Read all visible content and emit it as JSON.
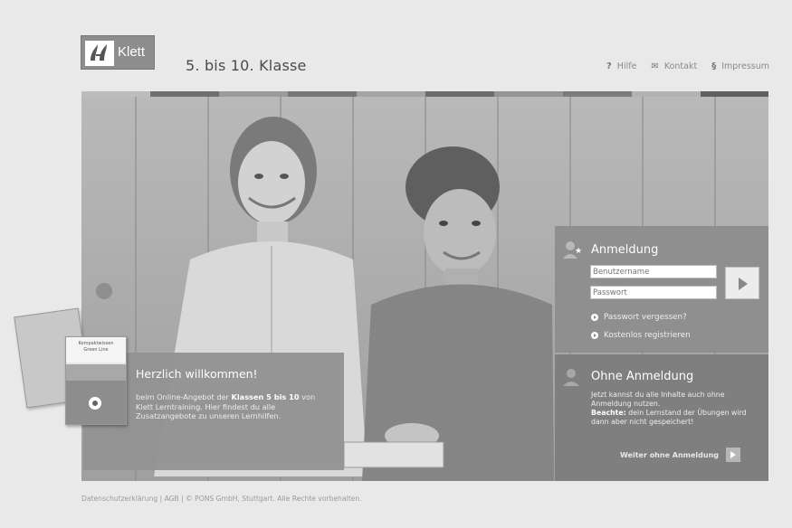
{
  "header": {
    "logo_text": "Klett",
    "grade_title": "5. bis 10. Klasse",
    "nav": [
      {
        "icon": "question-icon",
        "symbol": "?",
        "label": "Hilfe"
      },
      {
        "icon": "mail-icon",
        "symbol": "✉",
        "label": "Kontakt"
      },
      {
        "icon": "paragraph-icon",
        "symbol": "§",
        "label": "Impressum"
      }
    ]
  },
  "colorbar": [
    "#bdbdbd",
    "#6f6f6f",
    "#9a9a9a",
    "#777777",
    "#a4a4a4",
    "#6c6c6c",
    "#949494",
    "#7c7c7c",
    "#b2b2b2",
    "#5f5f5f"
  ],
  "welcome": {
    "title": "Herzlich willkommen!",
    "text_before": "beim Online-Angebot der ",
    "text_bold": "Klassen 5 bis 10",
    "text_after": " von Klett Lerntraining. Hier findest du alle Zusatzangebote zu unseren Lernhilfen."
  },
  "books": {
    "book2_line1": "Kompaktwissen",
    "book2_line2": "Green Line"
  },
  "login": {
    "title": "Anmeldung",
    "username_placeholder": "Benutzername",
    "password_placeholder": "Passwort",
    "forgot": "Passwort vergessen?",
    "register": "Kostenlos registrieren"
  },
  "nologin": {
    "title": "Ohne Anmeldung",
    "text": "Jetzt kannst du alle Inhalte auch ohne Anmeldung nutzen.",
    "note_label": "Beachte:",
    "note_text": " dein Lernstand der Übungen wird dann aber nicht gespeichert!",
    "continue": "Weiter ohne Anmeldung"
  },
  "footer": "Datenschutzerklärung | AGB | © PONS GmbH, Stuttgart. Alle Rechte vorbehalten."
}
